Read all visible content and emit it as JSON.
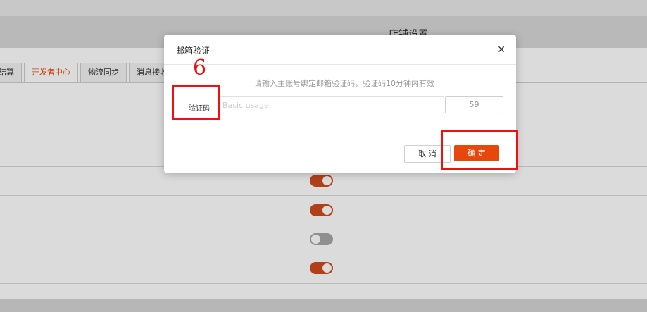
{
  "page": {
    "title": "店铺设置"
  },
  "tabs": [
    {
      "label": "结算",
      "active": false
    },
    {
      "label": "开发者中心",
      "active": true
    },
    {
      "label": "物流同步",
      "active": false
    },
    {
      "label": "消息接收",
      "active": false
    }
  ],
  "toggles": [
    {
      "on": true
    },
    {
      "on": true
    },
    {
      "on": false
    },
    {
      "on": true
    }
  ],
  "modal": {
    "title": "邮箱验证",
    "hint": "请输入主账号绑定邮箱验证码，验证码10分钟内有效",
    "code_label": "验证码",
    "code_placeholder": "Basic usage",
    "code_value": "",
    "countdown": "59",
    "cancel_label": "取 消",
    "ok_label": "确 定"
  },
  "annotation": {
    "number": "6",
    "color": "#ee1111"
  },
  "colors": {
    "accent": "#e8470b",
    "toggle_on": "#cf4b1e",
    "toggle_off": "#a7a7a7"
  }
}
